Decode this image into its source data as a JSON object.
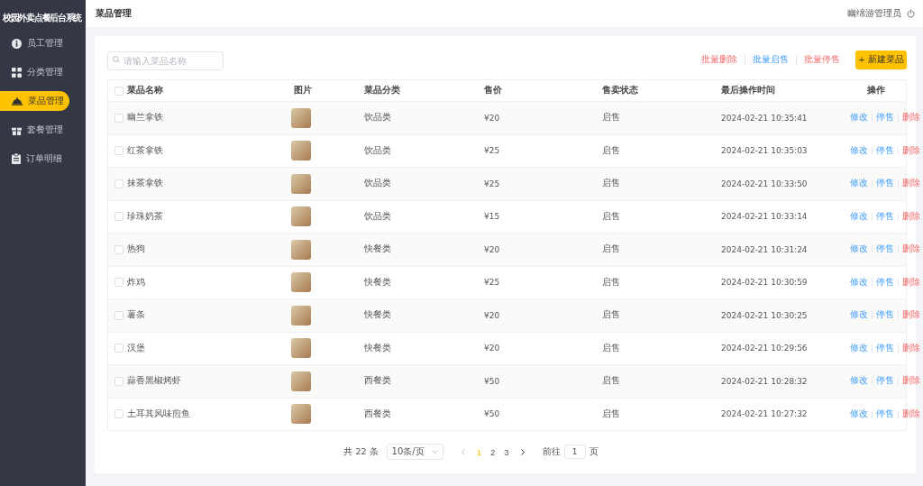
{
  "sidebar": {
    "title": "校园外卖点餐后台系统",
    "items": [
      {
        "label": "员工管理",
        "selected": false
      },
      {
        "label": "分类管理",
        "selected": false
      },
      {
        "label": "菜品管理",
        "selected": true
      },
      {
        "label": "套餐管理",
        "selected": false
      },
      {
        "label": "订单明细",
        "selected": false
      }
    ]
  },
  "header": {
    "title": "菜品管理",
    "user": "幽绵游管理员"
  },
  "toolbar": {
    "search": {
      "placeholder": "请输入菜品名称"
    },
    "batch_actions": [
      {
        "label": "批量删除",
        "kind": "danger"
      },
      {
        "label": "批量启售",
        "kind": "normal"
      },
      {
        "label": "批量停售",
        "kind": "danger"
      }
    ],
    "new_button": "+ 新建菜品"
  },
  "table": {
    "select_all": {
      "checked": false
    },
    "columns": [
      "菜品名称",
      "图片",
      "菜品分类",
      "售价",
      "售卖状态",
      "最后操作时间",
      "操作"
    ],
    "rows": [
      {
        "checked": false,
        "name": "幽兰拿铁",
        "category": "饮品类",
        "price": "¥20",
        "status": "启售",
        "updated": "2024-02-21 10:35:41",
        "actions": [
          {
            "label": "修改",
            "kind": "normal"
          },
          {
            "label": "停售",
            "kind": "normal"
          },
          {
            "label": "删除",
            "kind": "danger"
          }
        ]
      },
      {
        "checked": false,
        "name": "红茶拿铁",
        "category": "饮品类",
        "price": "¥25",
        "status": "启售",
        "updated": "2024-02-21 10:35:03",
        "actions": [
          {
            "label": "修改",
            "kind": "normal"
          },
          {
            "label": "停售",
            "kind": "normal"
          },
          {
            "label": "删除",
            "kind": "danger"
          }
        ]
      },
      {
        "checked": false,
        "name": "抹茶拿铁",
        "category": "饮品类",
        "price": "¥25",
        "status": "启售",
        "updated": "2024-02-21 10:33:50",
        "actions": [
          {
            "label": "修改",
            "kind": "normal"
          },
          {
            "label": "停售",
            "kind": "normal"
          },
          {
            "label": "删除",
            "kind": "danger"
          }
        ]
      },
      {
        "checked": false,
        "name": "珍珠奶茶",
        "category": "饮品类",
        "price": "¥15",
        "status": "启售",
        "updated": "2024-02-21 10:33:14",
        "actions": [
          {
            "label": "修改",
            "kind": "normal"
          },
          {
            "label": "停售",
            "kind": "normal"
          },
          {
            "label": "删除",
            "kind": "danger"
          }
        ]
      },
      {
        "checked": false,
        "name": "热狗",
        "category": "快餐类",
        "price": "¥20",
        "status": "启售",
        "updated": "2024-02-21 10:31:24",
        "actions": [
          {
            "label": "修改",
            "kind": "normal"
          },
          {
            "label": "停售",
            "kind": "normal"
          },
          {
            "label": "删除",
            "kind": "danger"
          }
        ]
      },
      {
        "checked": false,
        "name": "炸鸡",
        "category": "快餐类",
        "price": "¥25",
        "status": "启售",
        "updated": "2024-02-21 10:30:59",
        "actions": [
          {
            "label": "修改",
            "kind": "normal"
          },
          {
            "label": "停售",
            "kind": "normal"
          },
          {
            "label": "删除",
            "kind": "danger"
          }
        ]
      },
      {
        "checked": false,
        "name": "薯条",
        "category": "快餐类",
        "price": "¥20",
        "status": "启售",
        "updated": "2024-02-21 10:30:25",
        "actions": [
          {
            "label": "修改",
            "kind": "normal"
          },
          {
            "label": "停售",
            "kind": "normal"
          },
          {
            "label": "删除",
            "kind": "danger"
          }
        ]
      },
      {
        "checked": false,
        "name": "汉堡",
        "category": "快餐类",
        "price": "¥20",
        "status": "启售",
        "updated": "2024-02-21 10:29:56",
        "actions": [
          {
            "label": "修改",
            "kind": "normal"
          },
          {
            "label": "停售",
            "kind": "normal"
          },
          {
            "label": "删除",
            "kind": "danger"
          }
        ]
      },
      {
        "checked": false,
        "name": "蒜香黑椒烤虾",
        "category": "西餐类",
        "price": "¥50",
        "status": "启售",
        "updated": "2024-02-21 10:28:32",
        "actions": [
          {
            "label": "修改",
            "kind": "normal"
          },
          {
            "label": "停售",
            "kind": "normal"
          },
          {
            "label": "删除",
            "kind": "danger"
          }
        ]
      },
      {
        "checked": false,
        "name": "土耳其风味煎鱼",
        "category": "西餐类",
        "price": "¥50",
        "status": "启售",
        "updated": "2024-02-21 10:27:32",
        "actions": [
          {
            "label": "修改",
            "kind": "normal"
          },
          {
            "label": "停售",
            "kind": "normal"
          },
          {
            "label": "删除",
            "kind": "danger"
          }
        ]
      }
    ]
  },
  "pagination": {
    "total": "共 22 条",
    "page_size": "10条/页",
    "pages": [
      {
        "label": "1",
        "selected": true
      },
      {
        "label": "2",
        "selected": false
      },
      {
        "label": "3",
        "selected": false
      }
    ],
    "goto_label": "前往",
    "goto_value": "1",
    "goto_suffix": "页"
  }
}
